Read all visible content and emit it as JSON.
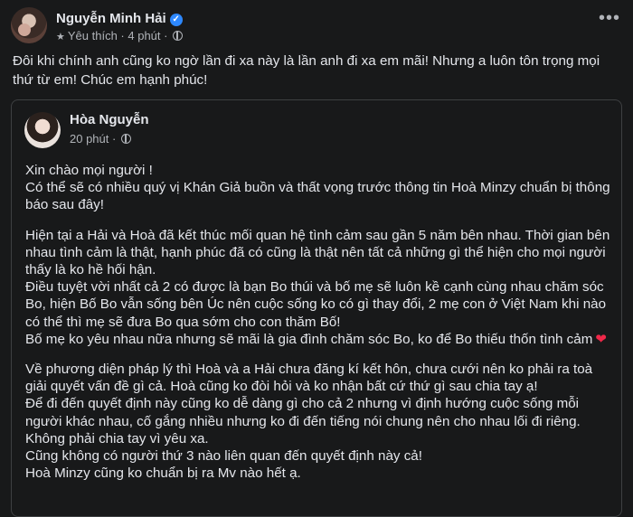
{
  "post": {
    "author": "Nguyễn Minh Hải",
    "audience": "Yêu thích",
    "time": "4 phút",
    "text": "Đôi khi chính anh cũng ko ngờ lần đi xa này là lần anh đi xa em mãi! Nhưng a luôn tôn trọng mọi thứ từ em! Chúc em hạnh phúc!",
    "icons": {
      "verified": "verified-badge-icon",
      "audience": "star-icon",
      "privacy": "globe-icon",
      "menu": "more-options-icon"
    }
  },
  "shared": {
    "author": "Hòa Nguyễn",
    "time": "20 phút",
    "paragraphs": [
      "Xin chào mọi người !",
      "Có thể sẽ có nhiều quý vị Khán Giả buồn và thất vọng trước thông tin Hoà Minzy chuẩn bị thông báo sau đây!",
      "",
      "Hiện tại a Hải và Hoà đã kết thúc mối quan hệ tình cảm sau gần 5 năm bên nhau. Thời gian bên nhau tình cảm là thật, hạnh phúc đã có cũng là thật nên tất cả những gì thể hiện cho mọi người thấy là ko hề hối hận.",
      "Điều tuyệt vời nhất cả 2 có được là bạn Bo thúi và bố mẹ sẽ luôn kề cạnh cùng nhau chăm sóc Bo, hiện Bố Bo vẫn sống bên Úc nên cuộc sống ko có gì thay đổi, 2 mẹ con ở Việt Nam khi nào có thể thì mẹ sẽ đưa Bo qua sớm cho con thăm Bố!",
      "Bố mẹ ko yêu nhau nữa nhưng sẽ mãi là gia đình chăm sóc Bo, ko để Bo thiếu thốn tình cảm",
      "",
      "Về phương diện pháp lý thì Hoà và a Hải chưa đăng kí kết hôn, chưa cưới nên ko phải ra toà giải quyết vấn đề gì cả. Hoà cũng ko đòi hỏi và ko nhận bất cứ thứ gì sau chia tay ạ!",
      "Để đi đến quyết định này cũng ko dễ dàng gì cho cả 2 nhưng vì định hướng cuộc sống mỗi người khác nhau, cố gắng nhiều nhưng ko đi đến tiếng nói chung nên cho nhau lối đi riêng.",
      "Không phải chia tay vì yêu xa.",
      "Cũng không có người thứ 3 nào liên quan đến quyết định này cả!",
      "Hoà Minzy cũng ko chuẩn bị ra Mv nào hết ạ."
    ],
    "heart_glyph": "❤"
  }
}
